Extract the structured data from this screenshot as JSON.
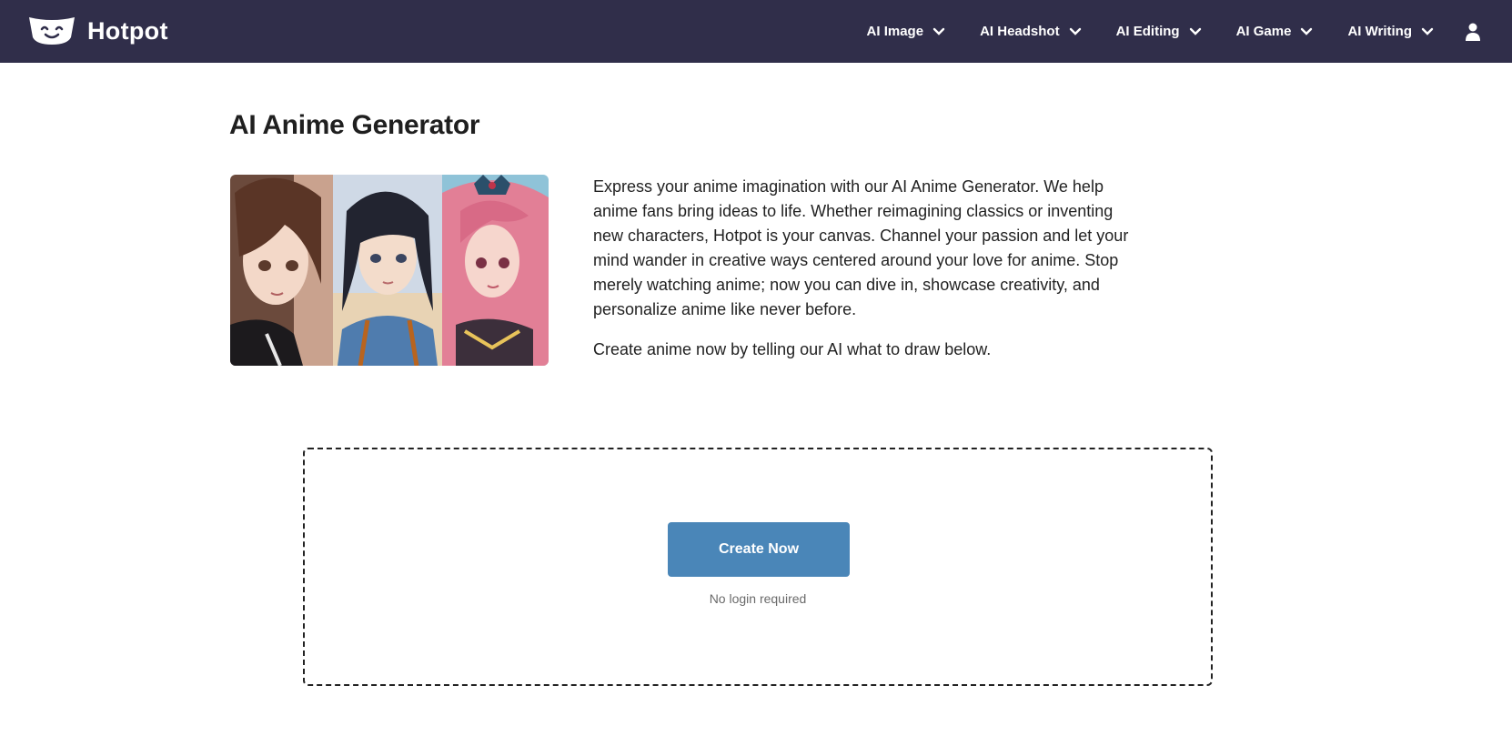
{
  "header": {
    "brand": "Hotpot",
    "nav": [
      {
        "label": "AI Image"
      },
      {
        "label": "AI Headshot"
      },
      {
        "label": "AI Editing"
      },
      {
        "label": "AI Game"
      },
      {
        "label": "AI Writing"
      }
    ]
  },
  "main": {
    "title": "AI Anime Generator",
    "description": "Express your anime imagination with our AI Anime Generator. We help anime fans bring ideas to life. Whether reimagining classics or inventing new characters, Hotpot is your canvas. Channel your passion and let your mind wander in creative ways centered around your love for anime. Stop merely watching anime; now you can dive in, showcase creativity, and personalize anime like never before.",
    "cta_text": "Create anime now by telling our AI what to draw below."
  },
  "create": {
    "button_label": "Create Now",
    "note": "No login required"
  },
  "colors": {
    "header_bg": "#302e4a",
    "button_bg": "#4a86b8"
  }
}
